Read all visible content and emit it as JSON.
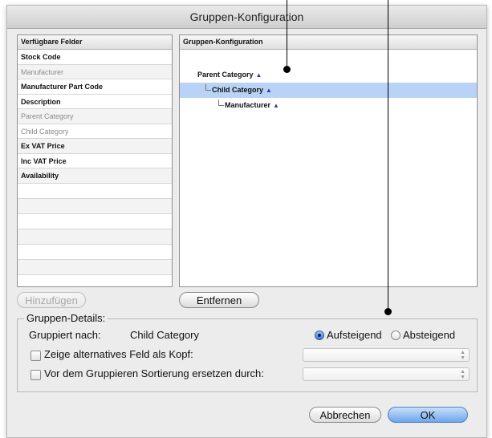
{
  "window": {
    "title": "Gruppen-Konfiguration"
  },
  "available_fields": {
    "header": "Verfügbare Felder",
    "items": [
      {
        "label": "Stock Code",
        "enabled": true
      },
      {
        "label": "Manufacturer",
        "enabled": false
      },
      {
        "label": "Manufacturer Part Code",
        "enabled": true
      },
      {
        "label": "Description",
        "enabled": true
      },
      {
        "label": "Parent Category",
        "enabled": false
      },
      {
        "label": "Child Category",
        "enabled": false
      },
      {
        "label": "Ex VAT Price",
        "enabled": true
      },
      {
        "label": "Inc VAT Price",
        "enabled": true
      },
      {
        "label": "Availability",
        "enabled": true
      }
    ]
  },
  "group_config": {
    "header": "Gruppen-Konfiguration",
    "tree": [
      {
        "label": "Parent Category",
        "sort_icon": "triangle-up-icon",
        "level": 0,
        "selected": false
      },
      {
        "label": "Child Category",
        "sort_icon": "triangle-up-icon",
        "level": 1,
        "selected": true
      },
      {
        "label": "Manufacturer",
        "sort_icon": "triangle-up-icon",
        "level": 2,
        "selected": false
      }
    ]
  },
  "buttons": {
    "add": "Hinzufügen",
    "remove": "Entfernen",
    "cancel": "Abbrechen",
    "ok": "OK"
  },
  "details": {
    "title": "Gruppen-Details:",
    "grouped_by_label": "Gruppiert nach:",
    "grouped_by_value": "Child Category",
    "ascending": "Aufsteigend",
    "descending": "Absteigend",
    "sort_order": "ascending",
    "alt_header_label": "Zeige alternatives Feld als Kopf:",
    "alt_header_checked": false,
    "replace_sort_label": "Vor dem Gruppieren Sortierung ersetzen durch:",
    "replace_sort_checked": false
  },
  "colors": {
    "selection": "#b8d3f5",
    "sort_triangle": "#3a3aa8",
    "ok_button": "#6fa6ea"
  }
}
